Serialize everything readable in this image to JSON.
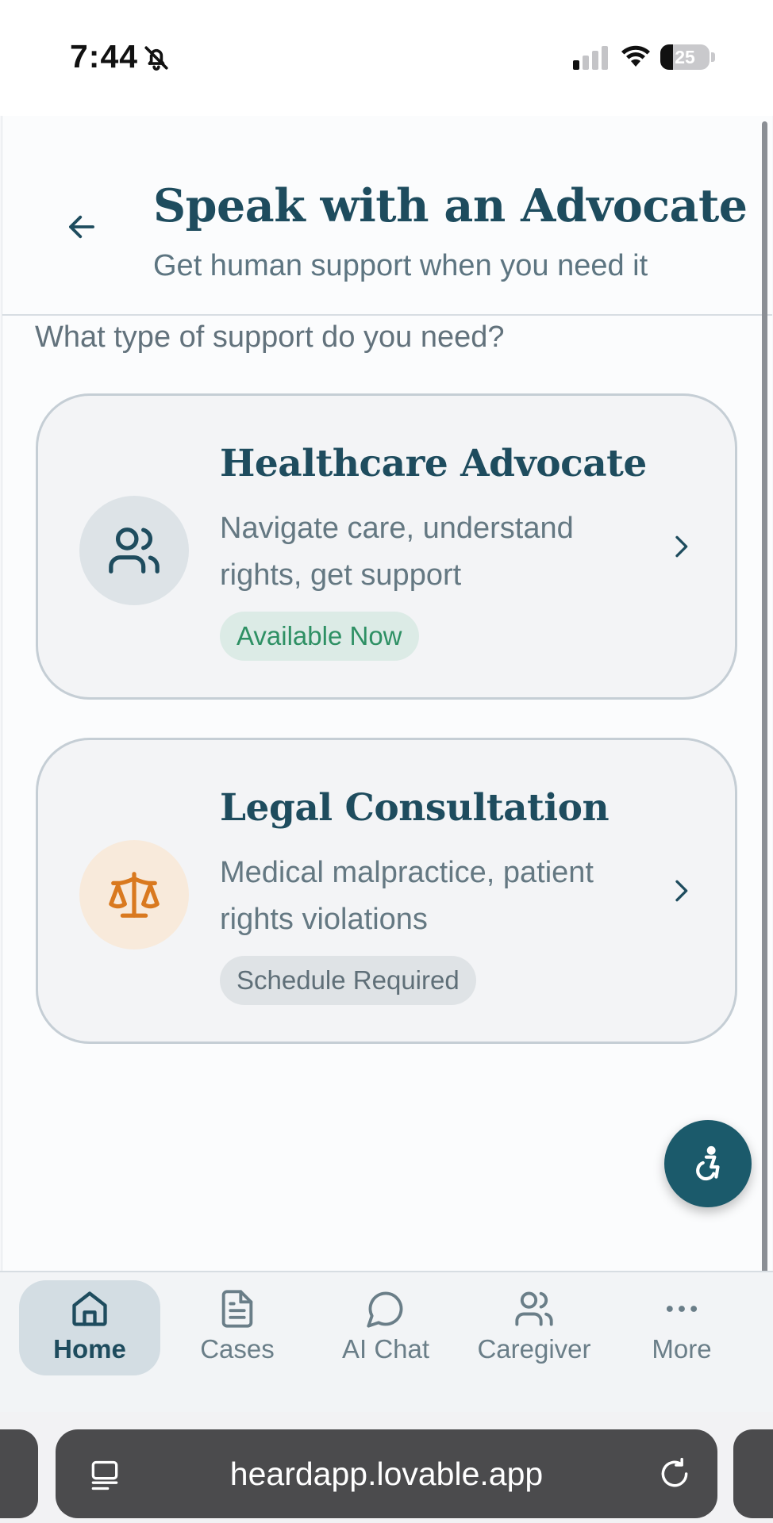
{
  "status_bar": {
    "time": "7:44",
    "battery": "25",
    "battery_level": 0.25
  },
  "header": {
    "title": "Speak with an Advocate",
    "subtitle": "Get human support when you need it"
  },
  "question": "What type of support do you need?",
  "cards": [
    {
      "title": "Healthcare Advocate",
      "description": "Navigate care, understand rights, get support",
      "badge": "Available Now",
      "icon": "users-icon",
      "accent": "#1e4c5e",
      "badge_color": "#2e9064"
    },
    {
      "title": "Legal Consultation",
      "description": "Medical malpractice, patient rights violations",
      "badge": "Schedule Required",
      "icon": "scale-icon",
      "accent": "#d9791f",
      "badge_color": "#5f6f78"
    }
  ],
  "bottom_nav": [
    {
      "label": "Home",
      "icon": "home-icon",
      "active": true
    },
    {
      "label": "Cases",
      "icon": "document-icon",
      "active": false
    },
    {
      "label": "AI Chat",
      "icon": "chat-bubble-icon",
      "active": false
    },
    {
      "label": "Caregiver",
      "icon": "users-icon",
      "active": false
    },
    {
      "label": "More",
      "icon": "more-dots-icon",
      "active": false
    }
  ],
  "browser": {
    "url": "heardapp.lovable.app"
  },
  "colors": {
    "primary": "#1e4c5e",
    "fab": "#1b5a6b",
    "success": "#2e9064",
    "legal": "#d9791f"
  }
}
